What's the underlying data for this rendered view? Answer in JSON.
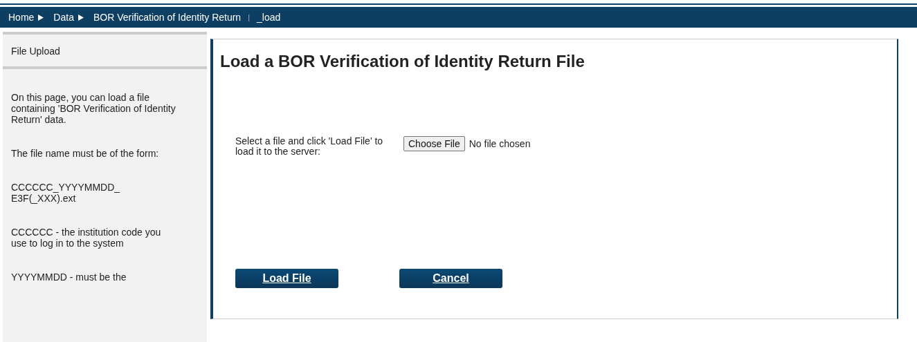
{
  "breadcrumb": {
    "items": [
      {
        "label": "Home"
      },
      {
        "label": "Data"
      }
    ],
    "current": "BOR Verification of Identity Return",
    "separator": "|",
    "suffix": "_load"
  },
  "sidebar": {
    "title": "File Upload",
    "paragraphs": [
      "On this page, you can load a file containing 'BOR Verification of Identity Return' data.",
      "The file name must be of the form:",
      "CCCCCC_YYYYMMDD_ E3F(_XXX).ext",
      "CCCCCC - the institution code you use to log in to the system",
      "YYYYMMDD - must be the"
    ]
  },
  "main": {
    "title": "Load a BOR Verification of Identity Return File",
    "field_label": "Select a file and click 'Load File' to load it to the server:",
    "file_button": "Choose File",
    "file_status": "No file chosen",
    "buttons": [
      "Load File",
      "Cancel"
    ]
  }
}
